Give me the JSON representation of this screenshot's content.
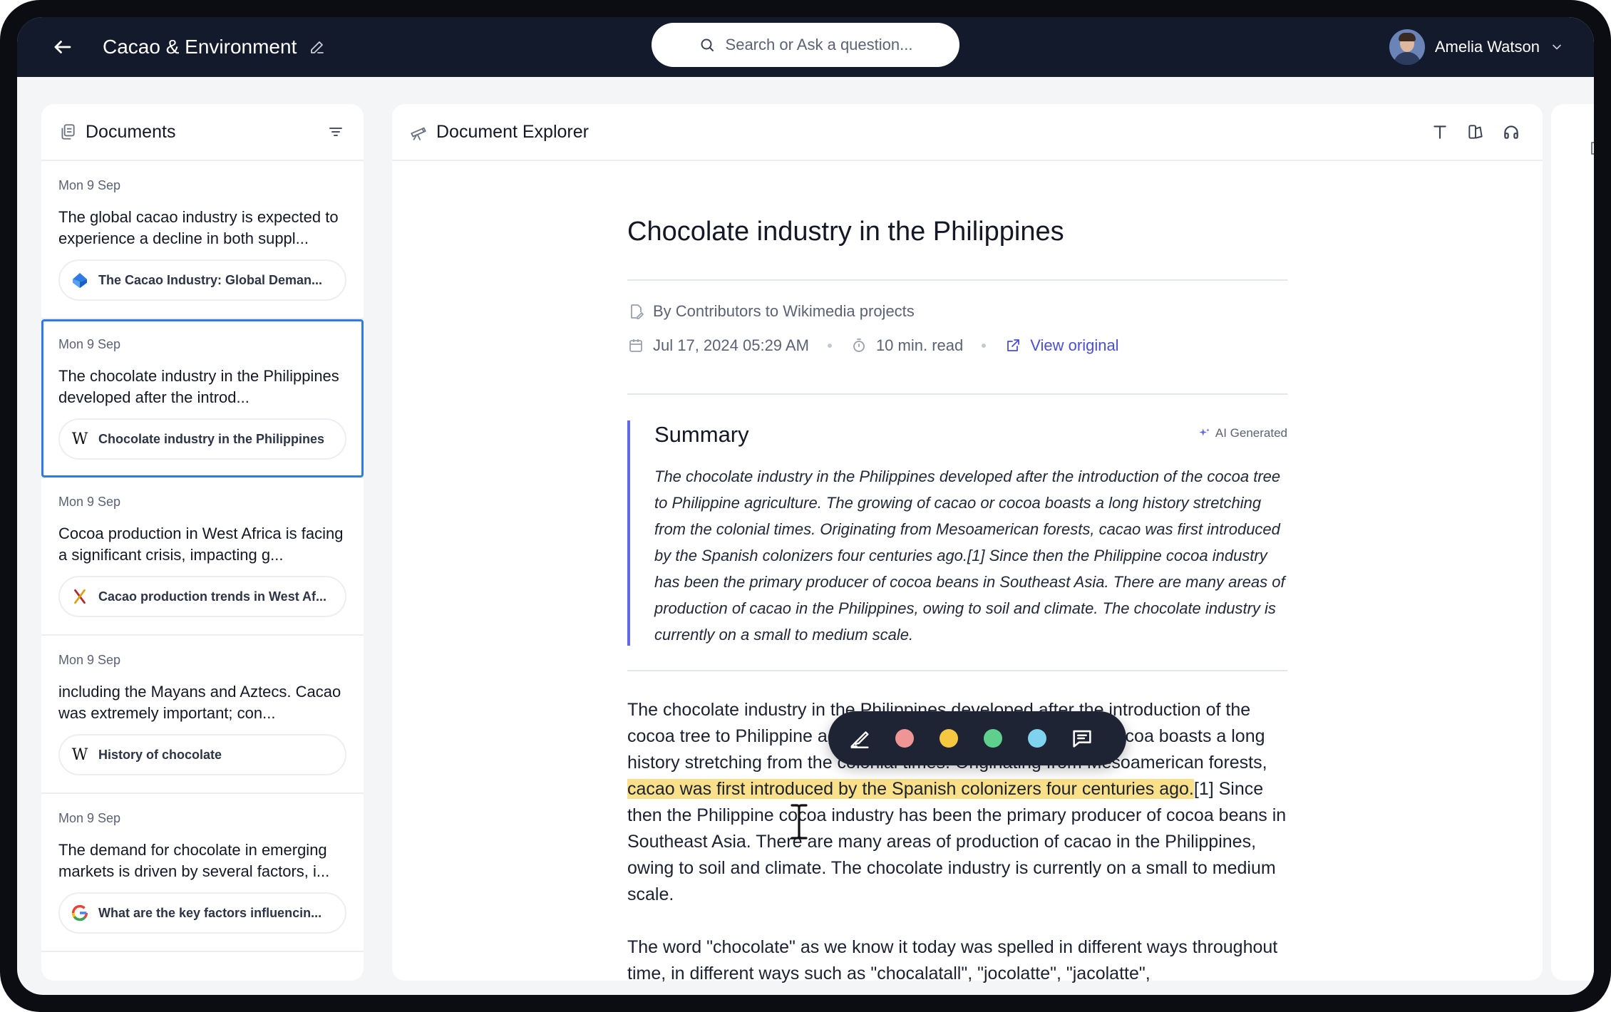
{
  "topbar": {
    "project_title": "Cacao & Environment",
    "search_placeholder": "Search or Ask a question...",
    "user_name": "Amelia Watson"
  },
  "documents": {
    "title": "Documents",
    "items": [
      {
        "date": "Mon 9 Sep",
        "text": "The global cacao industry is expected to experience a decline in both suppl...",
        "source": "The Cacao Industry: Global Deman...",
        "source_icon": "perplexity-icon",
        "selected": false
      },
      {
        "date": "Mon 9 Sep",
        "text": "The chocolate industry in the Philippines developed after the introd...",
        "source": "Chocolate industry in the Philippines",
        "source_icon": "wikipedia-icon",
        "selected": true
      },
      {
        "date": "Mon 9 Sep",
        "text": "Cocoa production in West Africa is facing a significant crisis, impacting g...",
        "source": "Cacao production trends in West Af...",
        "source_icon": "brand-x-icon",
        "selected": false
      },
      {
        "date": "Mon 9 Sep",
        "text": "including the Mayans and Aztecs. Cacao was extremely important; con...",
        "source": "History of chocolate",
        "source_icon": "wikipedia-icon",
        "selected": false
      },
      {
        "date": "Mon 9 Sep",
        "text": "The demand for chocolate in emerging markets is driven by several factors, i...",
        "source": "What are the key factors influencin...",
        "source_icon": "google-icon",
        "selected": false
      }
    ]
  },
  "explorer": {
    "title": "Document Explorer",
    "article": {
      "title": "Chocolate industry in the Philippines",
      "author": "By Contributors to Wikimedia projects",
      "date": "Jul 17, 2024 05:29 AM",
      "read_time": "10 min. read",
      "view_original": "View original",
      "summary_title": "Summary",
      "ai_badge": "AI Generated",
      "summary_text": "The chocolate industry in the Philippines developed after the introduction of the cocoa tree to Philippine agriculture. The growing of cacao or cocoa boasts a long history stretching from the colonial times. Originating from Mesoamerican forests, cacao was first introduced by the Spanish colonizers four centuries ago.[1] Since then the Philippine cocoa industry has been the primary producer of cocoa beans in Southeast Asia. There are many areas of production of cacao in the Philippines, owing to soil and climate. The chocolate industry is currently on a small to medium scale.",
      "para1_before": "The chocolate industry in the Philippines developed after the introduction of the cocoa tree to Philippine agriculture. The growing of cacao or cocoa boasts a long history stretching from the colonial times. Originating from Mesoamerican forests, ",
      "para1_highlight": "cacao was first introduced by the Spanish colonizers four centuries ago.",
      "para1_after": "[1] Since then the Philippine cocoa industry has been the primary producer of cocoa beans in Southeast Asia. There are many areas of production of cacao in the Philippines, owing to soil and climate. The chocolate industry is currently on a small to medium scale.",
      "para2": "The word \"chocolate\" as we know it today was spelled in different ways throughout time, in different ways such as \"chocalatall\", \"jocolatte\", \"jacolatte\","
    }
  },
  "highlight_colors": [
    "#f09595",
    "#f5c842",
    "#5fcf8d",
    "#7fd3ee"
  ],
  "colors": {
    "accent": "#4a4fd3",
    "selection": "#2f7be6",
    "highlight": "#fbe08a",
    "topbar": "#131a2c"
  }
}
